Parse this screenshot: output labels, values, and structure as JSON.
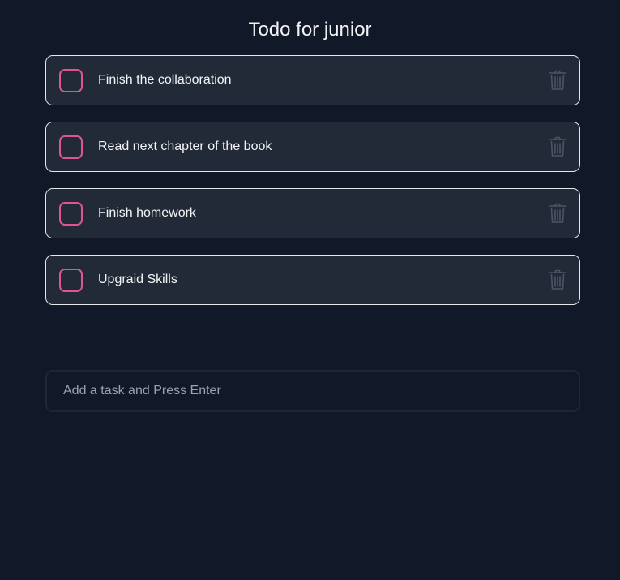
{
  "header": {
    "title": "Todo for junior"
  },
  "todos": [
    {
      "text": "Finish the collaboration",
      "completed": false,
      "delete_icon": "trash-icon"
    },
    {
      "text": "Read next chapter of the book",
      "completed": false,
      "delete_icon": "trash-icon"
    },
    {
      "text": "Finish homework",
      "completed": false,
      "delete_icon": "trash-icon"
    },
    {
      "text": "Upgraid Skills",
      "completed": false,
      "delete_icon": "trash-icon"
    }
  ],
  "add_task": {
    "value": "",
    "placeholder": "Add a task and Press Enter"
  },
  "colors": {
    "background": "#111827",
    "card": "#222a38",
    "card_border": "#e5e7eb",
    "checkbox_accent": "#e0548f",
    "trash_icon": "#4b5563",
    "text": "#f3f4f6",
    "placeholder": "#9ca3af"
  }
}
